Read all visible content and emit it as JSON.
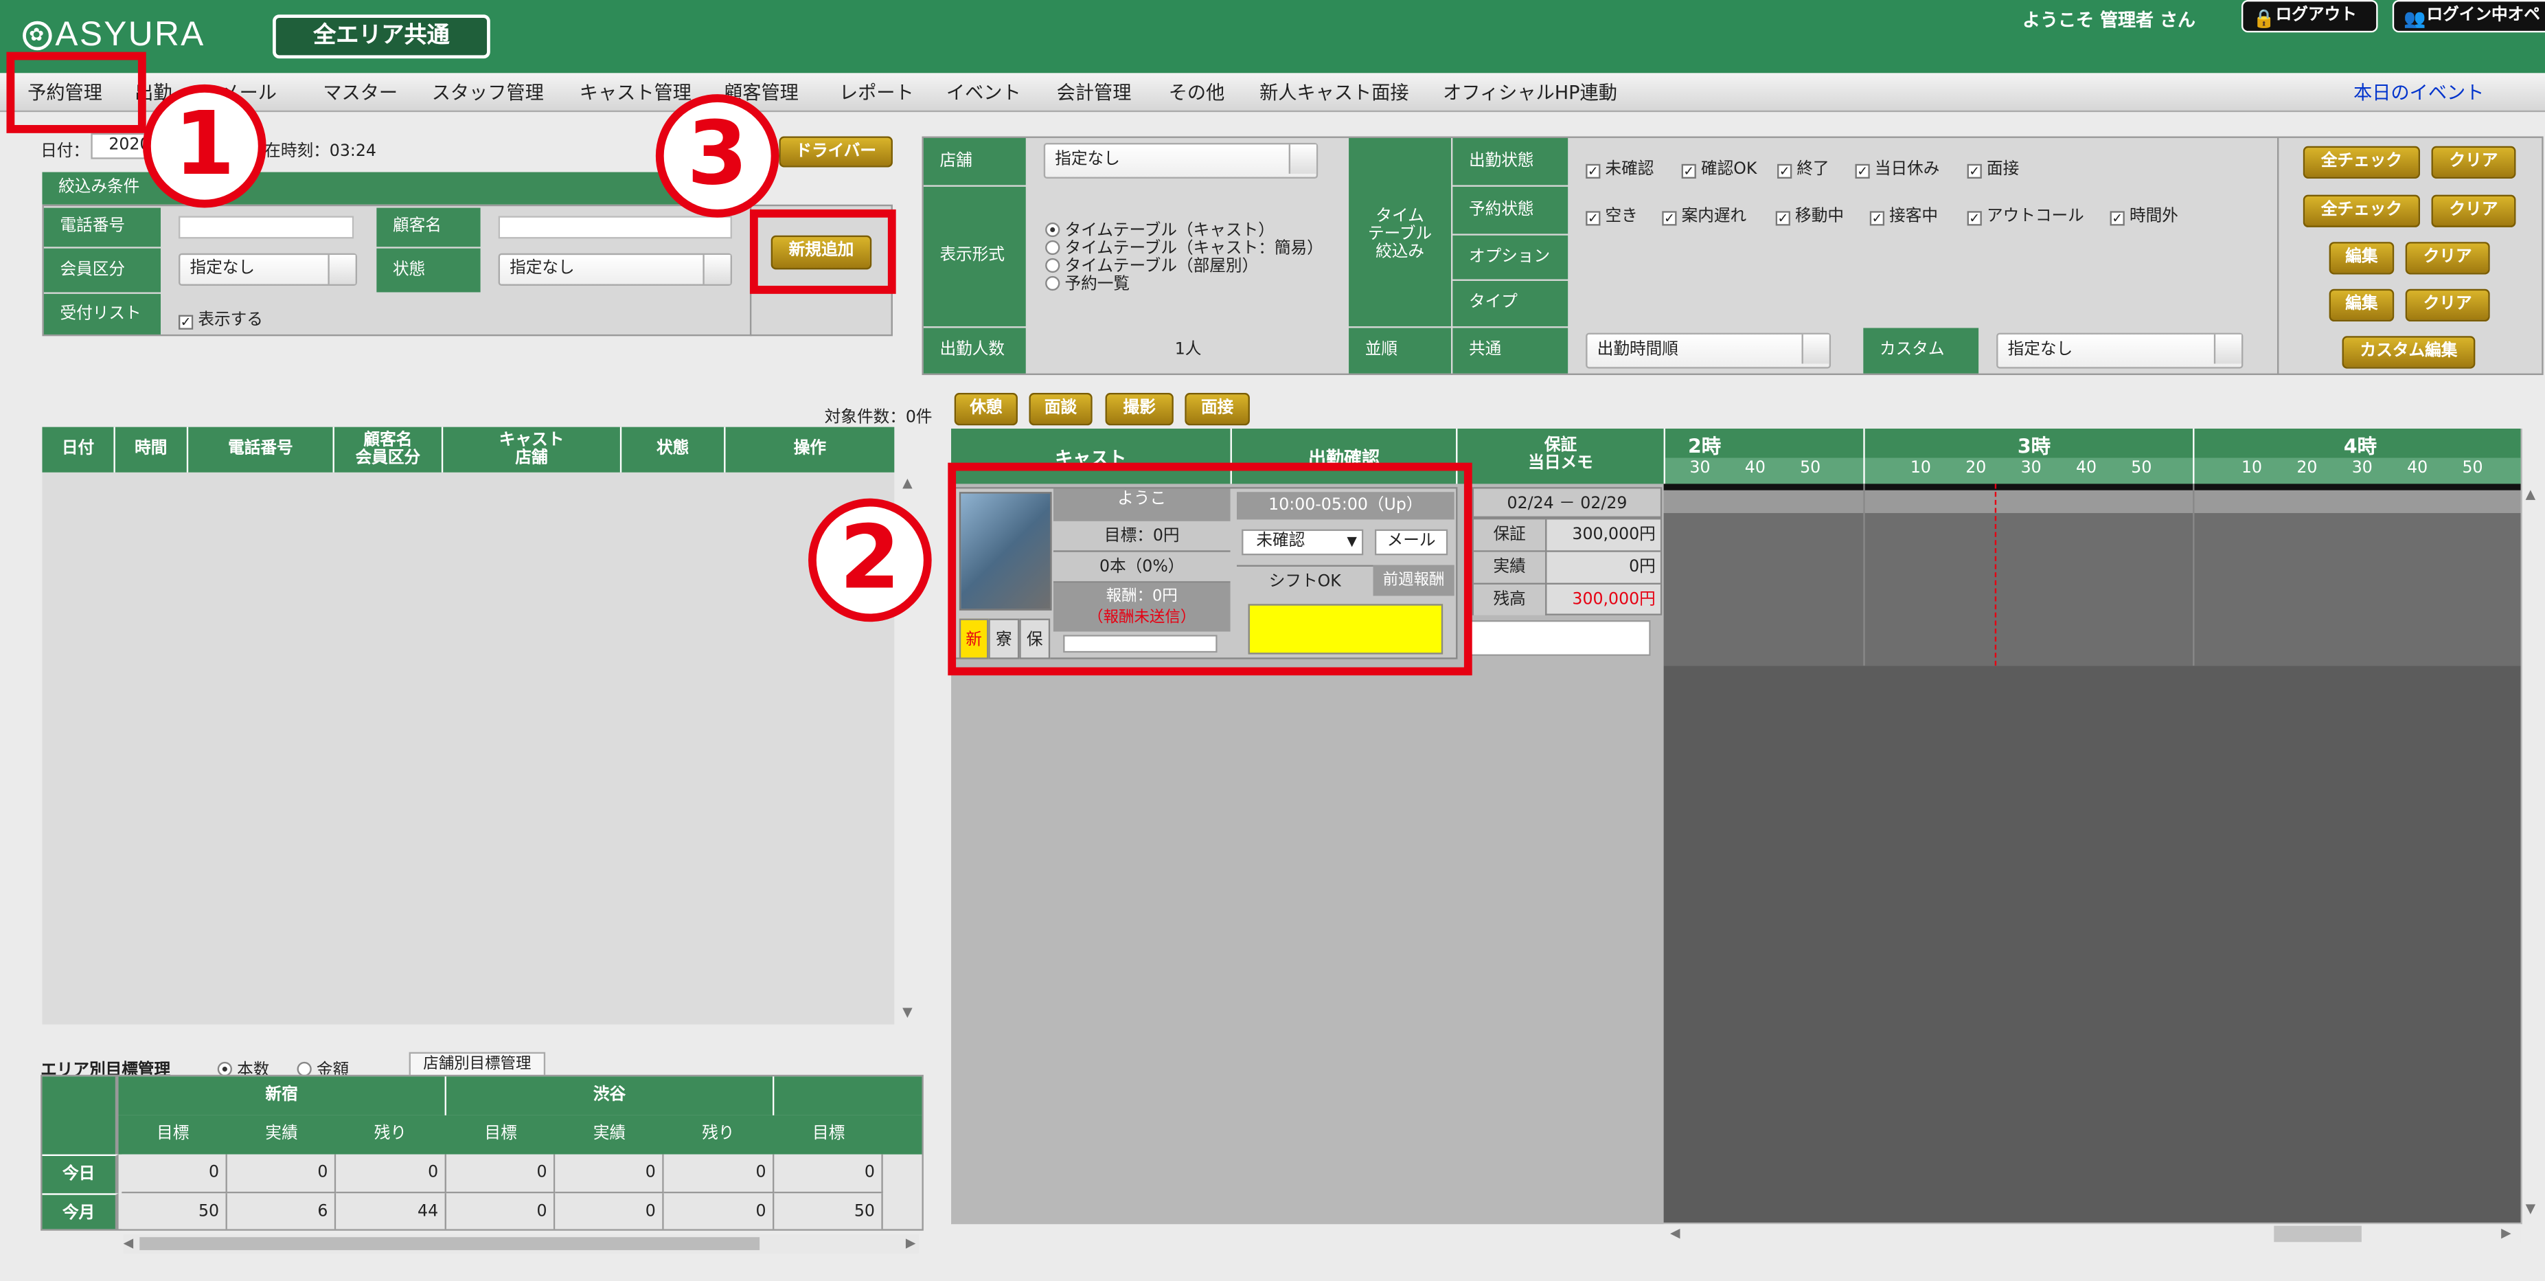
{
  "header": {
    "logo": "ASYURA",
    "area_button": "全エリア共通",
    "welcome": "ようこそ 管理者 さん",
    "logout": "ログアウト",
    "login_ops": "ログイン中オペ"
  },
  "menu": {
    "items": [
      "予約管理",
      "出勤",
      "メール",
      "マスター",
      "スタッフ管理",
      "キャスト管理",
      "顧客管理",
      "レポート",
      "イベント",
      "会計管理",
      "その他",
      "新人キャスト面接",
      "オフィシャルHP連動"
    ],
    "event_link": "本日のイベント"
  },
  "annotations": [
    "1",
    "2",
    "3"
  ],
  "left": {
    "date_label": "日付：",
    "date_value": "2020/02/25",
    "current_time": "現在時刻：03:24",
    "driver_button": "ドライバー",
    "filter_title": "絞込み条件",
    "phone_label": "電話番号",
    "customer_label": "顧客名",
    "member_label": "会員区分",
    "member_value": "指定なし",
    "status_label": "状態",
    "status_value": "指定なし",
    "reception_label": "受付リスト",
    "reception_check": "表示する",
    "new_button": "新規追加",
    "count_text": "対象件数：0件",
    "columns": [
      "日付",
      "時間",
      "電話番号",
      "顧客名\n会員区分",
      "キャスト\n店舗",
      "状態",
      "操作"
    ]
  },
  "targets": {
    "title": "エリア別目標管理",
    "radio_count": "本数",
    "radio_amount": "金額",
    "store_button": "店舗別目標管理",
    "areas": [
      "新宿",
      "渋谷",
      "【"
    ],
    "subcols": [
      "目標",
      "実績",
      "残り"
    ],
    "rows": [
      {
        "label": "今日",
        "values": [
          "0",
          "0",
          "0",
          "0",
          "0",
          "0",
          "0"
        ]
      },
      {
        "label": "今月",
        "values": [
          "50",
          "6",
          "44",
          "0",
          "0",
          "0",
          "50"
        ]
      }
    ]
  },
  "right": {
    "store_label": "店舗",
    "store_value": "指定なし",
    "display_label": "表示形式",
    "display_options": [
      "タイムテーブル（キャスト）",
      "タイムテーブル（キャスト：簡易）",
      "タイムテーブル（部屋別）",
      "予約一覧"
    ],
    "timetable_filter_label": "タイム\nテーブル\n絞込み",
    "attend_label": "出勤状態",
    "attend_checks": [
      "未確認",
      "確認OK",
      "終了",
      "当日休み",
      "面接"
    ],
    "reserve_label": "予約状態",
    "reserve_checks": [
      "空き",
      "案内遅れ",
      "移動中",
      "接客中",
      "アウトコール",
      "時間外"
    ],
    "option_label": "オプション",
    "type_label": "タイプ",
    "check_all": "全チェック",
    "clear": "クリア",
    "edit": "編集",
    "staff_count_label": "出勤人数",
    "staff_count_value": "1人",
    "sort_label": "並順",
    "common_label": "共通",
    "common_value": "出勤時間順",
    "custom_label": "カスタム",
    "custom_value": "指定なし",
    "custom_edit": "カスタム編集"
  },
  "quick_buttons": [
    "休憩",
    "面談",
    "撮影",
    "面接"
  ],
  "timeline": {
    "cast_header": "キャスト",
    "confirm_header": "出勤確認",
    "guarantee_header": "保証\n当日メモ",
    "hours": [
      "2時",
      "3時",
      "4時"
    ],
    "minutes": [
      "30",
      "40",
      "50",
      "10",
      "20",
      "30",
      "40",
      "50",
      "10",
      "20",
      "30",
      "40",
      "50"
    ]
  },
  "cast": {
    "name": "ようこ",
    "target": "目標：0円",
    "count": "0本（0%）",
    "reward": "報酬：0円",
    "reward_status": "（報酬未送信）",
    "tags": [
      "新",
      "寮",
      "保"
    ],
    "shift_time": "10:00-05:00（Up）",
    "confirm_value": "未確認",
    "mail_button": "メール",
    "shift_ok": "シフトOK",
    "last_week": "前週報酬",
    "period": "02/24 － 02/29",
    "guarantee_rows": [
      {
        "label": "保証",
        "value": "300,000円"
      },
      {
        "label": "実績",
        "value": "0円"
      },
      {
        "label": "残高",
        "value": "300,000円"
      }
    ]
  },
  "colors": {
    "green": "#3d8b59",
    "red": "#e60012",
    "gold": "#c49a1a",
    "yellow": "#ffff00"
  }
}
